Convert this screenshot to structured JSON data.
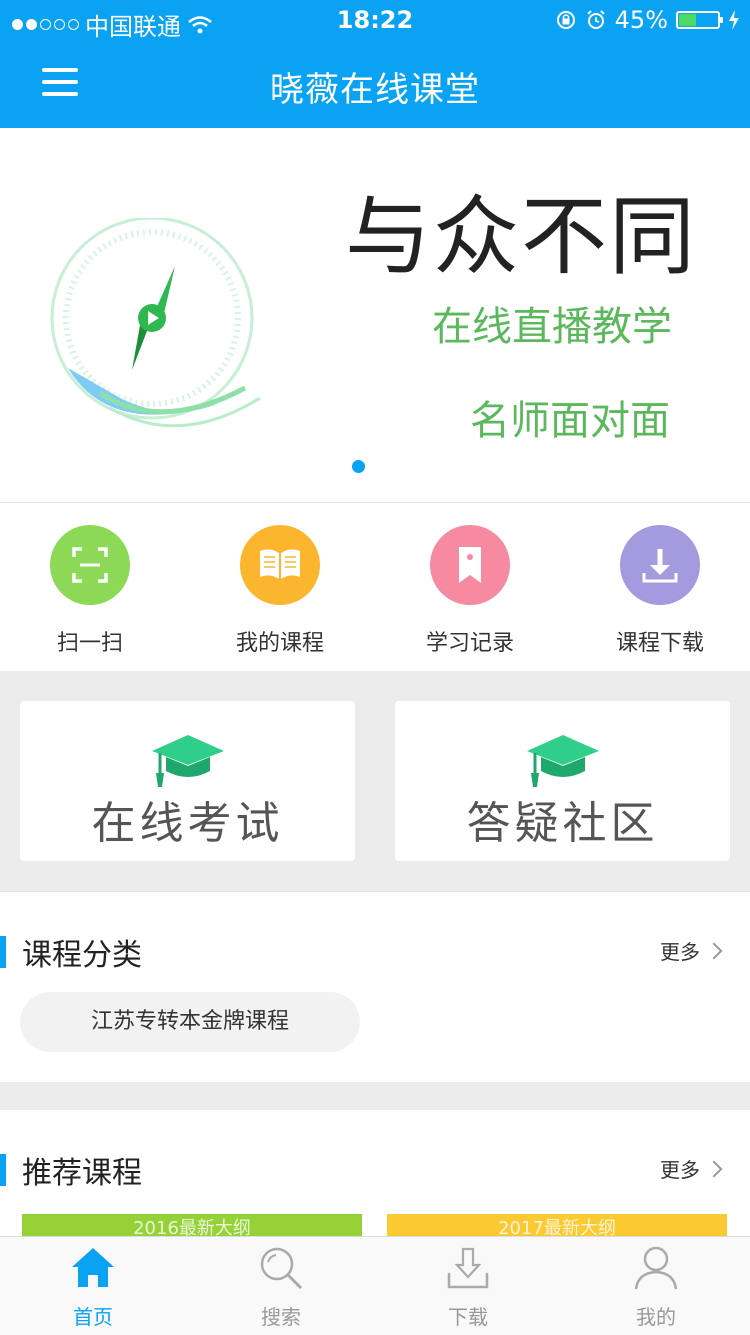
{
  "status_bar": {
    "carrier": "中国联通",
    "time": "18:22",
    "battery": "45%",
    "battery_level": 0.45
  },
  "nav": {
    "title": "晓薇在线课堂",
    "menu_icon": "hamburger-menu-icon"
  },
  "banner": {
    "headline": "与众不同",
    "line1": "在线直播教学",
    "line2": "名师面对面",
    "page_count": 1,
    "active_page": 1
  },
  "quick_actions": [
    {
      "label": "扫一扫",
      "icon": "scan-icon",
      "color": "#8bd954"
    },
    {
      "label": "我的课程",
      "icon": "book-icon",
      "color": "#fcb52f"
    },
    {
      "label": "学习记录",
      "icon": "bookmark-icon",
      "color": "#f58aa0"
    },
    {
      "label": "课程下载",
      "icon": "download-icon",
      "color": "#a49bdf"
    }
  ],
  "feature_cards": [
    {
      "label": "在线考试",
      "icon": "graduation-cap-icon"
    },
    {
      "label": "答疑社区",
      "icon": "graduation-cap-icon"
    }
  ],
  "course_category": {
    "title": "课程分类",
    "more": "更多",
    "items": [
      "江苏专转本金牌课程"
    ]
  },
  "recommended": {
    "title": "推荐课程",
    "more": "更多",
    "thumbs": [
      {
        "label": "2016最新大纲",
        "color": "#94d238"
      },
      {
        "label": "2017最新大纲",
        "color": "#fbc931"
      }
    ]
  },
  "tabbar": [
    {
      "label": "首页",
      "icon": "home-icon",
      "active": true
    },
    {
      "label": "搜索",
      "icon": "search-icon",
      "active": false
    },
    {
      "label": "下载",
      "icon": "download-tray-icon",
      "active": false
    },
    {
      "label": "我的",
      "icon": "user-icon",
      "active": false
    }
  ],
  "colors": {
    "primary": "#0aa3f4",
    "banner_green": "#5cb85c",
    "card_cap": "#2fcf8a"
  }
}
